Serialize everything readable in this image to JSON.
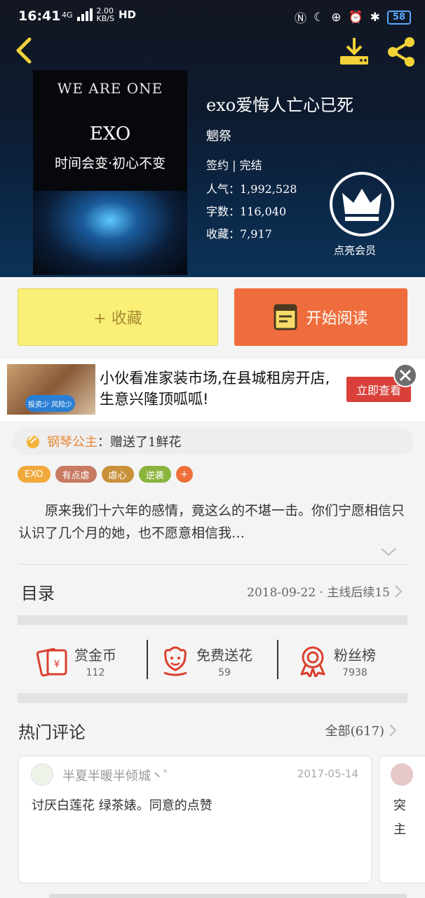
{
  "status_bar": {
    "time": "16:41",
    "net_type": "4G",
    "speed": "2.00",
    "speed_unit": "KB/S",
    "hd": "HD",
    "battery": "58"
  },
  "book": {
    "cover_line1": "WE ARE ONE",
    "cover_line2": "EXO",
    "cover_line3": "时间会变·初心不变",
    "title": "exo爱悔人亡心已死",
    "author": "魍祭",
    "status": "签约 | 完结",
    "popularity": "人气：1,992,528",
    "word_count": "字数：116,040",
    "favorites": "收藏：7,917",
    "vip_label": "点亮会员"
  },
  "actions": {
    "favorite_label": "+ 收藏",
    "read_label": "开始阅读"
  },
  "ad": {
    "image_tag": "投资少 风险少",
    "text": "小伙看准家装市场,在县城租房开店,生意兴隆顶呱呱!",
    "cta": "立即查看"
  },
  "gift": {
    "name": "钢琴公主",
    "message": "：赠送了1鲜花"
  },
  "tags": [
    {
      "label": "EXO",
      "color": "#f0a93a"
    },
    {
      "label": "有点虐",
      "color": "#c87a62"
    },
    {
      "label": "虐心",
      "color": "#c9913a"
    },
    {
      "label": "逆袭",
      "color": "#8ab43c"
    },
    {
      "label": "+",
      "color": "#ee6f3a"
    }
  ],
  "description": "原来我们十六年的感情，竟这么的不堪一击。你们宁愿相信只认识了几个月的她，也不愿意相信我…",
  "toc": {
    "label": "目录",
    "update": "2018-09-22 · 主线后续15"
  },
  "stats": [
    {
      "label": "赏金币",
      "value": "112",
      "icon": "red-envelope-icon"
    },
    {
      "label": "免费送花",
      "value": "59",
      "icon": "flower-icon"
    },
    {
      "label": "粉丝榜",
      "value": "7938",
      "icon": "medal-icon"
    }
  ],
  "comments": {
    "title": "热门评论",
    "all_label": "全部(617)",
    "items": [
      {
        "user": "半夏半暖半倾城丶゜",
        "date": "2017-05-14",
        "text": "讨厌白莲花 绿茶婊。同意的点赞"
      },
      {
        "user": "",
        "date": "",
        "text": "突主"
      }
    ]
  },
  "colors": {
    "accent_orange": "#ef6d3c",
    "favorite_yellow": "#faf078"
  }
}
